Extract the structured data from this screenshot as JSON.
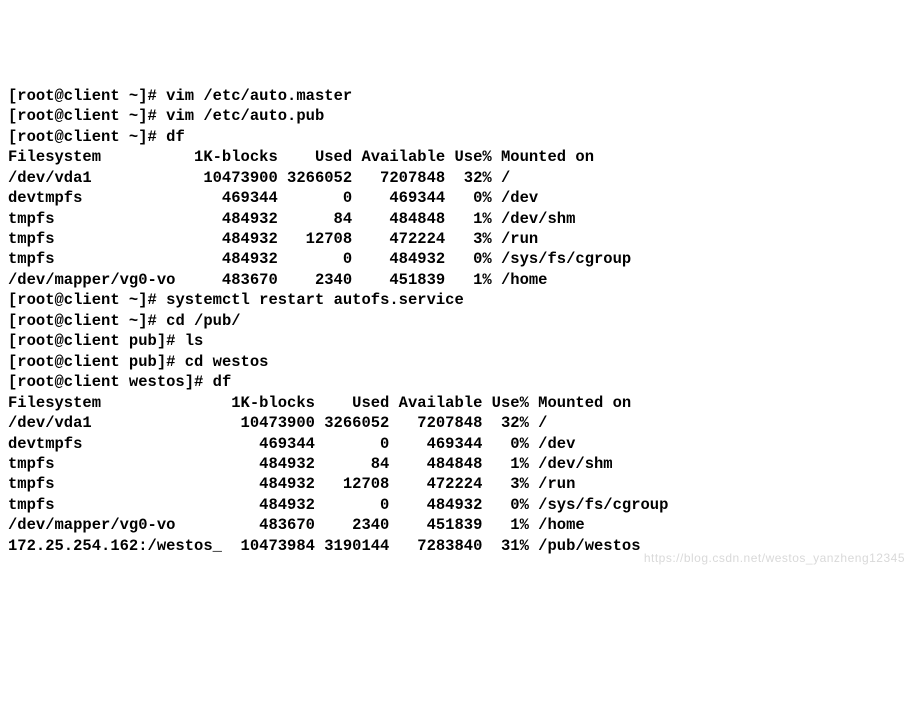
{
  "prompts": {
    "home": "[root@client ~]# ",
    "pub": "[root@client pub]# ",
    "westos": "[root@client westos]# "
  },
  "commands": {
    "vim_master": "vim /etc/auto.master",
    "vim_pub": "vim /etc/auto.pub",
    "df1": "df",
    "restart": "systemctl restart autofs.service",
    "cd_pub": "cd /pub/",
    "ls": "ls",
    "cd_westos": "cd westos",
    "df2": "df"
  },
  "df1": {
    "header": {
      "fs": "Filesystem",
      "blocks": "1K-blocks",
      "used": "Used",
      "avail": "Available",
      "usep": "Use%",
      "mount": "Mounted on"
    },
    "rows": [
      {
        "fs": "/dev/vda1",
        "blocks": "10473900",
        "used": "3266052",
        "avail": "7207848",
        "usep": "32%",
        "mount": "/"
      },
      {
        "fs": "devtmpfs",
        "blocks": "469344",
        "used": "0",
        "avail": "469344",
        "usep": "0%",
        "mount": "/dev"
      },
      {
        "fs": "tmpfs",
        "blocks": "484932",
        "used": "84",
        "avail": "484848",
        "usep": "1%",
        "mount": "/dev/shm"
      },
      {
        "fs": "tmpfs",
        "blocks": "484932",
        "used": "12708",
        "avail": "472224",
        "usep": "3%",
        "mount": "/run"
      },
      {
        "fs": "tmpfs",
        "blocks": "484932",
        "used": "0",
        "avail": "484932",
        "usep": "0%",
        "mount": "/sys/fs/cgroup"
      },
      {
        "fs": "/dev/mapper/vg0-vo",
        "blocks": "483670",
        "used": "2340",
        "avail": "451839",
        "usep": "1%",
        "mount": "/home"
      }
    ]
  },
  "df2": {
    "header": {
      "fs": "Filesystem",
      "blocks": "1K-blocks",
      "used": "Used",
      "avail": "Available",
      "usep": "Use%",
      "mount": "Mounted on"
    },
    "rows": [
      {
        "fs": "/dev/vda1",
        "blocks": "10473900",
        "used": "3266052",
        "avail": "7207848",
        "usep": "32%",
        "mount": "/"
      },
      {
        "fs": "devtmpfs",
        "blocks": "469344",
        "used": "0",
        "avail": "469344",
        "usep": "0%",
        "mount": "/dev"
      },
      {
        "fs": "tmpfs",
        "blocks": "484932",
        "used": "84",
        "avail": "484848",
        "usep": "1%",
        "mount": "/dev/shm"
      },
      {
        "fs": "tmpfs",
        "blocks": "484932",
        "used": "12708",
        "avail": "472224",
        "usep": "3%",
        "mount": "/run"
      },
      {
        "fs": "tmpfs",
        "blocks": "484932",
        "used": "0",
        "avail": "484932",
        "usep": "0%",
        "mount": "/sys/fs/cgroup"
      },
      {
        "fs": "/dev/mapper/vg0-vo",
        "blocks": "483670",
        "used": "2340",
        "avail": "451839",
        "usep": "1%",
        "mount": "/home"
      },
      {
        "fs": "172.25.254.162:/westos_",
        "blocks": "10473984",
        "used": "3190144",
        "avail": "7283840",
        "usep": "31%",
        "mount": "/pub/westos"
      }
    ]
  },
  "watermark": "https://blog.csdn.net/westos_yanzheng12345"
}
